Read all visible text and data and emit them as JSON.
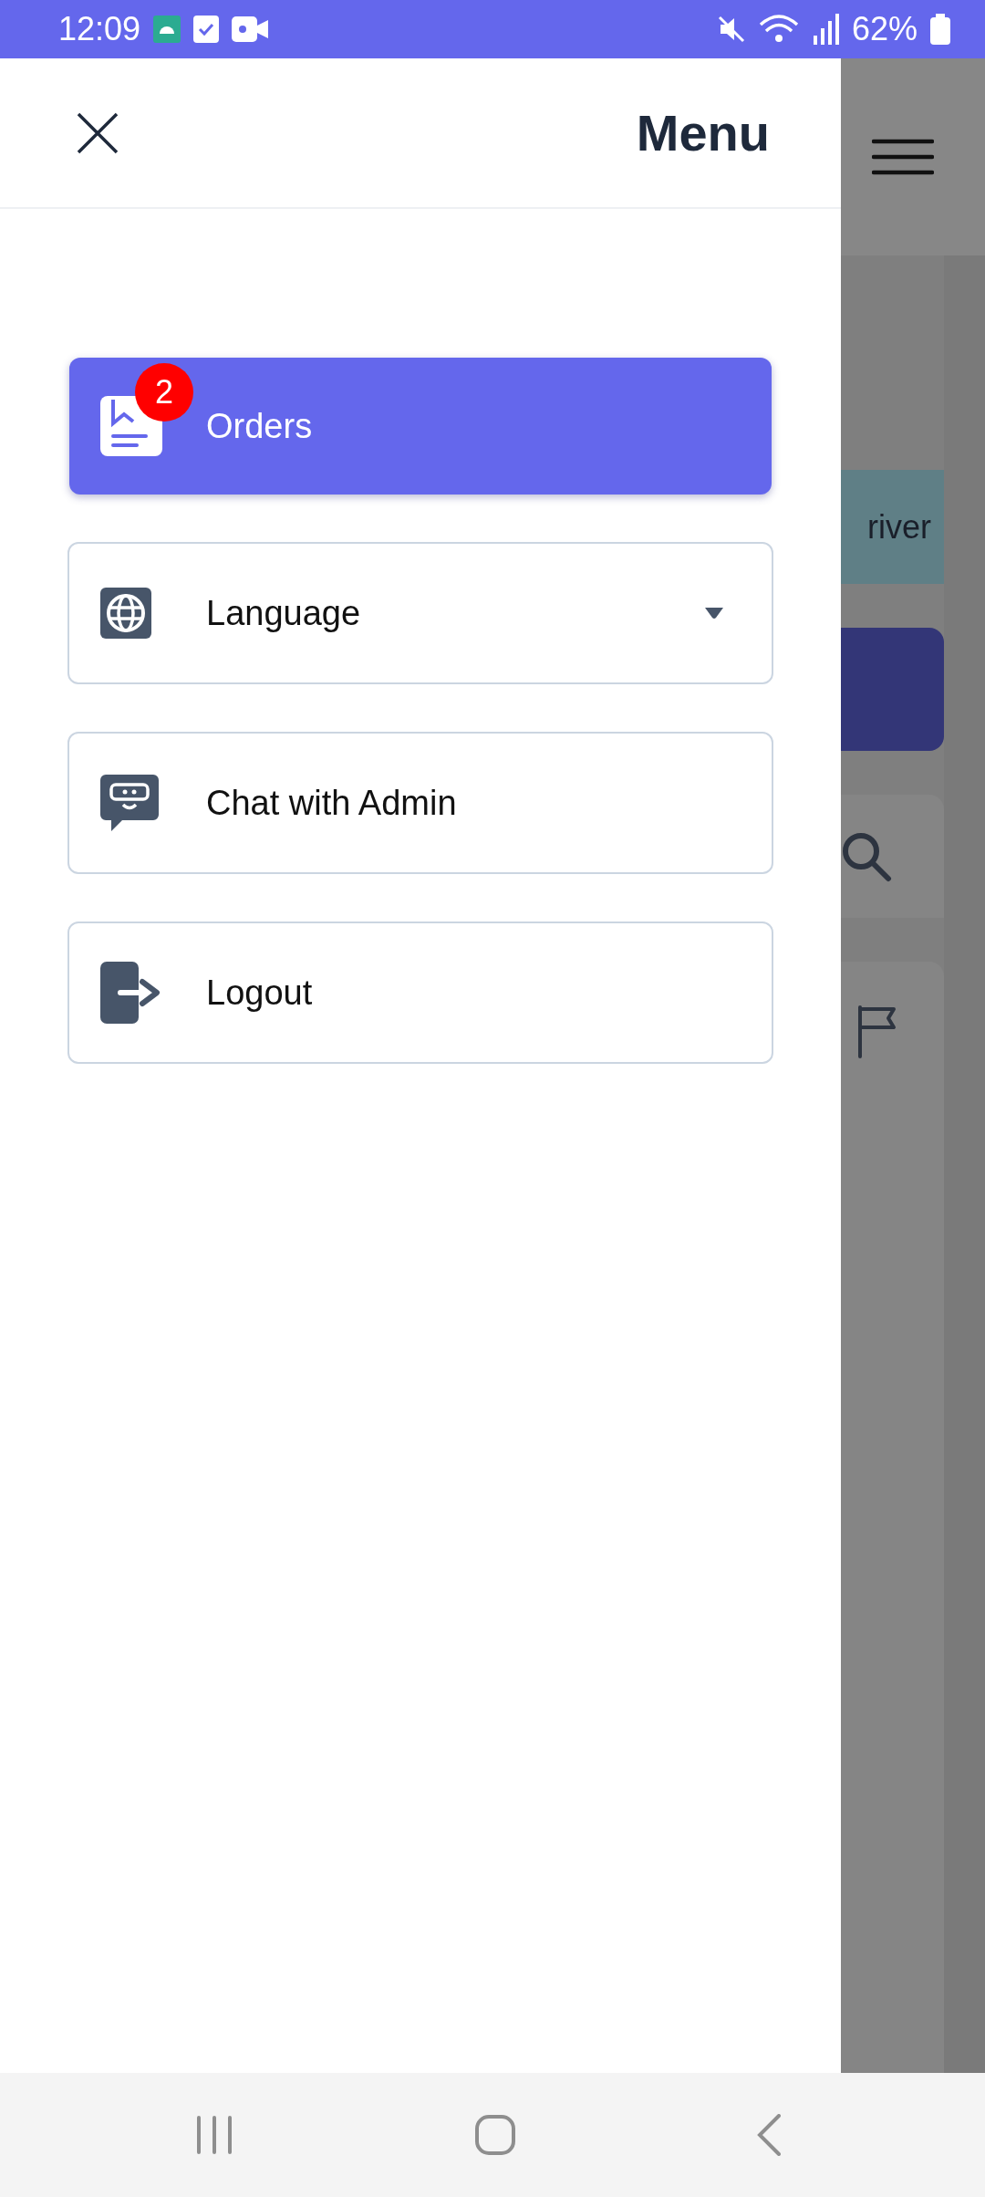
{
  "status_bar": {
    "time": "12:09",
    "battery": "62%"
  },
  "drawer": {
    "title": "Menu",
    "items": [
      {
        "kind": "orders",
        "label": "Orders",
        "selected": true,
        "badge": "2"
      },
      {
        "kind": "language",
        "label": "Language",
        "selected": false,
        "dropdown": true
      },
      {
        "kind": "chat",
        "label": "Chat with Admin",
        "selected": false
      },
      {
        "kind": "logout",
        "label": "Logout",
        "selected": false
      }
    ]
  },
  "background_page": {
    "banner_text": "river"
  }
}
